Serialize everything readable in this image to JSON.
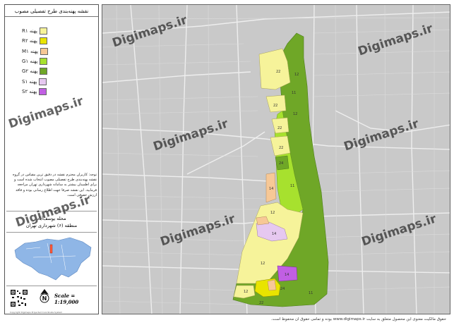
{
  "panel": {
    "title": "نقشه پهنه‌بندی طرح تفصیلی مصوب",
    "legend": [
      {
        "label": "پهنه R۱",
        "color": "#f6f39a"
      },
      {
        "label": "پهنه R۲",
        "color": "#e9e400"
      },
      {
        "label": "پهنه M۱",
        "color": "#f7c896"
      },
      {
        "label": "پهنه G۱",
        "color": "#a7e12e"
      },
      {
        "label": "پهنه G۲",
        "color": "#6fa727"
      },
      {
        "label": "پهنه S۱",
        "color": "#e6c8f0"
      },
      {
        "label": "پهنه S۲",
        "color": "#c15fe3"
      }
    ],
    "note": "توجه: کاربران محترم نقشه در دقیق ترین مقیاس در گروه نقشه پهنه‌بندی طرح تفصیلی مصوب انتخاب شده است و برای اطمینان بیشتر به سامانه شهرداری تهران مراجعه فرمایید. این نقشه صرفا جهت اطلاع رسانی بوده و فاقد ارزش حقوقی است.",
    "district_name": "محله یوسف‌آباد",
    "district_region": "منطقه (۶) شهرداری تهران",
    "scale": "Scale = 1:19,000",
    "north_label": "N",
    "footer": "Copyright Digimaps  Projected Coordinate System"
  },
  "map": {
    "watermark": "Digimaps.ir",
    "zone_labels": [
      "22",
      "12",
      "11",
      "22",
      "12",
      "22",
      "24",
      "11",
      "22",
      "14",
      "12",
      "12",
      "14",
      "14",
      "24",
      "12",
      "11",
      "22"
    ]
  },
  "credit": "حقوق مالکیت معنوی این محصول متعلق به سایت www.digimaps.ir بوده و تمامی حقوق آن محفوظ است."
}
